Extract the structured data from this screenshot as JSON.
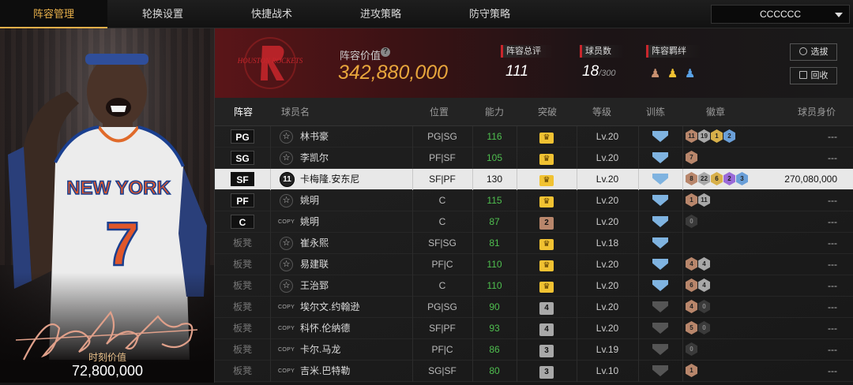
{
  "nav": {
    "tabs": [
      {
        "label": "阵容管理",
        "active": true
      },
      {
        "label": "轮换设置",
        "active": false
      },
      {
        "label": "快捷战术",
        "active": false
      },
      {
        "label": "进攻策略",
        "active": false
      },
      {
        "label": "防守策略",
        "active": false
      }
    ],
    "team_select": "CCCCCC"
  },
  "card": {
    "jersey_team": "NEW YORK",
    "jersey_number": "7",
    "value_label": "时刻价值",
    "value": "72,800,000"
  },
  "header": {
    "team_logo_text": "HOUSTON ROCKETS",
    "lineup_value_label": "阵容价值",
    "lineup_value": "342,880,000",
    "overall_label": "阵容总评",
    "overall": "111",
    "player_count_label": "球员数",
    "player_count": "18",
    "player_count_max": "/300",
    "bond_label": "阵容羁绊",
    "pick_button": "选拔",
    "recycle_button": "回收"
  },
  "table": {
    "headers": [
      "阵容",
      "球员名",
      "位置",
      "能力",
      "突破",
      "等级",
      "训练",
      "徽章",
      "球员身价"
    ],
    "rows": [
      {
        "slot": "PG",
        "starter": true,
        "icon": "star",
        "name": "林书豪",
        "pos": "PG|SG",
        "ability": "116",
        "ability_color": "#4fbf4f",
        "breakthrough": "crown",
        "level": "Lv.20",
        "train": "blue",
        "badges": [
          [
            "11",
            "#b8866b"
          ],
          [
            "19",
            "#a8a8a8"
          ],
          [
            "1",
            "#d8b04a"
          ],
          [
            "2",
            "#6a9fd8"
          ]
        ],
        "worth": "---",
        "selected": false
      },
      {
        "slot": "SG",
        "starter": true,
        "icon": "star",
        "name": "李凯尔",
        "pos": "PF|SF",
        "ability": "105",
        "ability_color": "#4fbf4f",
        "breakthrough": "crown",
        "level": "Lv.20",
        "train": "blue",
        "badges": [
          [
            "7",
            "#b8866b"
          ]
        ],
        "worth": "---",
        "selected": false
      },
      {
        "slot": "SF",
        "starter": true,
        "icon": "number",
        "icon_text": "11",
        "name": "卡梅隆.安东尼",
        "pos": "SF|PF",
        "ability": "130",
        "ability_color": "#111111",
        "breakthrough": "crown",
        "level": "Lv.20",
        "train": "blue",
        "badges": [
          [
            "8",
            "#b8866b"
          ],
          [
            "22",
            "#a8a8a8"
          ],
          [
            "6",
            "#d8b04a"
          ],
          [
            "2",
            "#9a6ad8"
          ],
          [
            "3",
            "#6a9fd8"
          ]
        ],
        "worth": "270,080,000",
        "selected": true
      },
      {
        "slot": "PF",
        "starter": true,
        "icon": "star",
        "name": "姚明",
        "pos": "C",
        "ability": "115",
        "ability_color": "#4fbf4f",
        "breakthrough": "crown",
        "level": "Lv.20",
        "train": "blue",
        "badges": [
          [
            "1",
            "#b8866b"
          ],
          [
            "11",
            "#a8a8a8"
          ]
        ],
        "worth": "---",
        "selected": false
      },
      {
        "slot": "C",
        "starter": true,
        "icon": "copy",
        "name": "姚明",
        "pos": "C",
        "ability": "87",
        "ability_color": "#4fbf4f",
        "breakthrough": "2",
        "breakthrough_color": "#b8866b",
        "level": "Lv.20",
        "train": "blue",
        "badges": [
          [
            "0",
            "#3a3a3a"
          ]
        ],
        "worth": "---",
        "selected": false
      },
      {
        "slot": "板凳",
        "starter": false,
        "icon": "star",
        "name": "崔永熙",
        "pos": "SF|SG",
        "ability": "81",
        "ability_color": "#4fbf4f",
        "breakthrough": "crown",
        "level": "Lv.18",
        "train": "blue",
        "badges": [],
        "worth": "---",
        "selected": false
      },
      {
        "slot": "板凳",
        "starter": false,
        "icon": "star",
        "name": "易建联",
        "pos": "PF|C",
        "ability": "110",
        "ability_color": "#4fbf4f",
        "breakthrough": "crown",
        "level": "Lv.20",
        "train": "blue",
        "badges": [
          [
            "4",
            "#b8866b"
          ],
          [
            "4",
            "#a8a8a8"
          ]
        ],
        "worth": "---",
        "selected": false
      },
      {
        "slot": "板凳",
        "starter": false,
        "icon": "star",
        "name": "王治郅",
        "pos": "C",
        "ability": "110",
        "ability_color": "#4fbf4f",
        "breakthrough": "crown",
        "level": "Lv.20",
        "train": "blue",
        "badges": [
          [
            "6",
            "#b8866b"
          ],
          [
            "4",
            "#a8a8a8"
          ]
        ],
        "worth": "---",
        "selected": false
      },
      {
        "slot": "板凳",
        "starter": false,
        "icon": "copy",
        "name": "埃尔文.约翰逊",
        "pos": "PG|SG",
        "ability": "90",
        "ability_color": "#4fbf4f",
        "breakthrough": "4",
        "breakthrough_color": "#a8a8a8",
        "level": "Lv.20",
        "train": "grey",
        "badges": [
          [
            "4",
            "#b8866b"
          ],
          [
            "0",
            "#3a3a3a"
          ]
        ],
        "worth": "---",
        "selected": false
      },
      {
        "slot": "板凳",
        "starter": false,
        "icon": "copy",
        "name": "科怀.伦纳德",
        "pos": "SF|PF",
        "ability": "93",
        "ability_color": "#4fbf4f",
        "breakthrough": "4",
        "breakthrough_color": "#a8a8a8",
        "level": "Lv.20",
        "train": "grey",
        "badges": [
          [
            "5",
            "#b8866b"
          ],
          [
            "0",
            "#3a3a3a"
          ]
        ],
        "worth": "---",
        "selected": false
      },
      {
        "slot": "板凳",
        "starter": false,
        "icon": "copy",
        "name": "卡尔.马龙",
        "pos": "PF|C",
        "ability": "86",
        "ability_color": "#4fbf4f",
        "breakthrough": "3",
        "breakthrough_color": "#a8a8a8",
        "level": "Lv.19",
        "train": "grey",
        "badges": [
          [
            "0",
            "#3a3a3a"
          ]
        ],
        "worth": "---",
        "selected": false
      },
      {
        "slot": "板凳",
        "starter": false,
        "icon": "copy",
        "name": "吉米.巴特勒",
        "pos": "SG|SF",
        "ability": "80",
        "ability_color": "#4fbf4f",
        "breakthrough": "3",
        "breakthrough_color": "#a8a8a8",
        "level": "Lv.10",
        "train": "grey",
        "badges": [
          [
            "1",
            "#b8866b"
          ]
        ],
        "worth": "---",
        "selected": false
      }
    ]
  },
  "colors": {
    "accent": "#e8a63c",
    "header_red": "#c9262c",
    "ability_green": "#4fbf4f"
  }
}
